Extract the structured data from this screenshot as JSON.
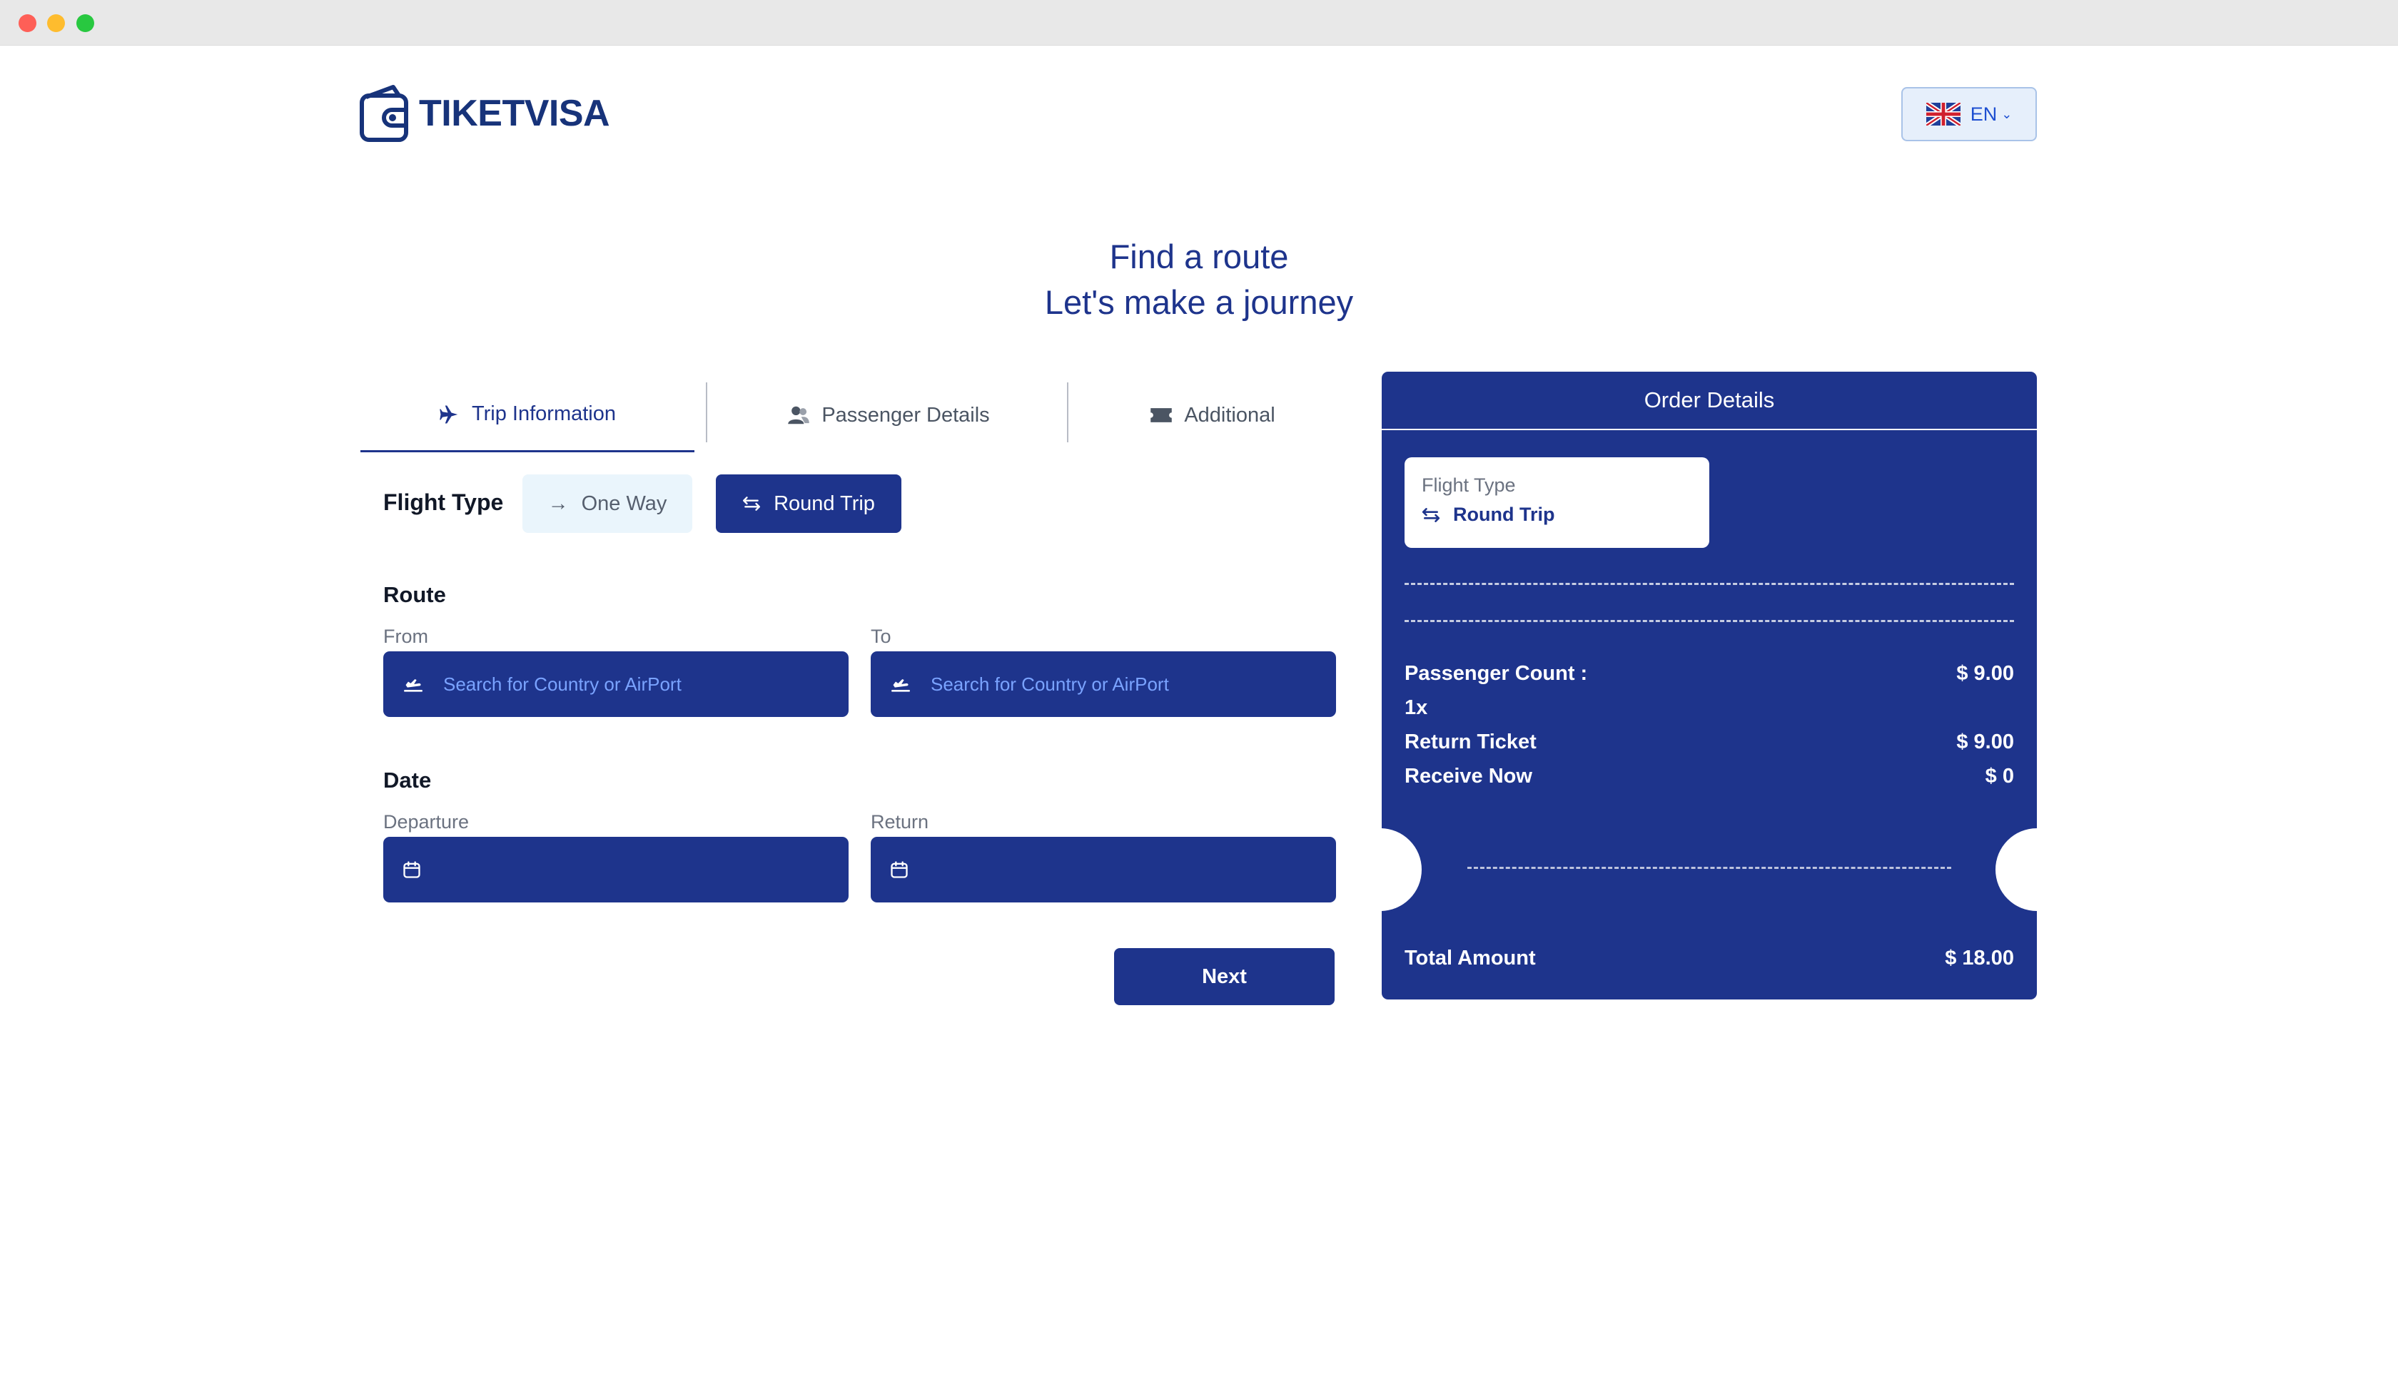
{
  "brand": {
    "name": "TIKETVISA"
  },
  "language": {
    "code": "EN",
    "flag_icon": "uk-flag-icon"
  },
  "hero": {
    "line1": "Find a route",
    "line2": "Let's make a journey"
  },
  "tabs": [
    {
      "label": "Trip Information",
      "icon": "plane-icon",
      "active": true
    },
    {
      "label": "Passenger Details",
      "icon": "passengers-icon",
      "active": false
    },
    {
      "label": "Additional",
      "icon": "ticket-icon",
      "active": false
    }
  ],
  "flight_type": {
    "label": "Flight Type",
    "options": [
      {
        "label": "One Way",
        "icon": "arrow-right-icon",
        "selected": false
      },
      {
        "label": "Round Trip",
        "icon": "swap-arrows-icon",
        "selected": true
      }
    ]
  },
  "route": {
    "title": "Route",
    "from": {
      "label": "From",
      "placeholder": "Search for Country or AirPort",
      "value": ""
    },
    "to": {
      "label": "To",
      "placeholder": "Search for Country or AirPort",
      "value": ""
    }
  },
  "date": {
    "title": "Date",
    "departure": {
      "label": "Departure",
      "value": ""
    },
    "return": {
      "label": "Return",
      "value": ""
    }
  },
  "next_label": "Next",
  "order": {
    "title": "Order Details",
    "flight_type_label": "Flight Type",
    "flight_type_value": "Round Trip",
    "passenger_count_label": "Passenger Count :",
    "passenger_count_value": "$ 9.00",
    "passenger_multiplier": "1x",
    "return_ticket_label": "Return Ticket",
    "return_ticket_value": "$ 9.00",
    "receive_now_label": "Receive Now",
    "receive_now_value": "$ 0",
    "total_label": "Total Amount",
    "total_value": "$ 18.00"
  },
  "colors": {
    "primary": "#1e348c",
    "placeholder": "#7aa3ff",
    "ghost_bg": "#eaf5fc"
  }
}
